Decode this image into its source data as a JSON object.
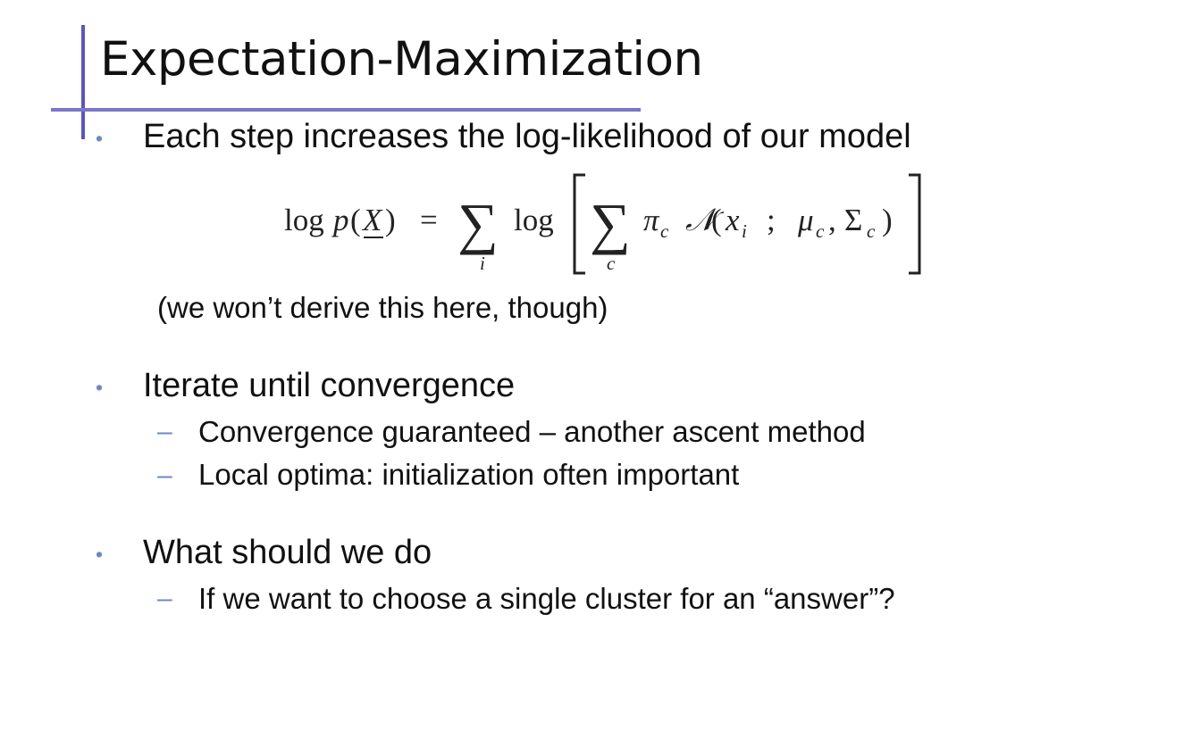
{
  "slide": {
    "title": "Expectation-Maximization",
    "bullets": [
      {
        "text": "Each step increases the log-likelihood of our model"
      },
      {
        "text": "Iterate until convergence",
        "subitems": [
          "Convergence guaranteed – another ascent method",
          "Local optima: initialization often important"
        ]
      },
      {
        "text": "What should we do",
        "subitems": [
          "If we want to choose a single cluster for an “answer”?"
        ]
      }
    ],
    "note": "(we won’t derive this here, though)",
    "equation": {
      "lhs": "log p(X)",
      "equals": "=",
      "sum_outer": "∑",
      "sum_outer_index": "i",
      "log": "log",
      "sum_inner": "∑",
      "sum_inner_index": "c",
      "term": "πc 𝒩(xi ; μc, Σc)"
    },
    "colors": {
      "accent": "#5a55c4",
      "bullet": "#6b88c8",
      "text": "#111111"
    }
  }
}
